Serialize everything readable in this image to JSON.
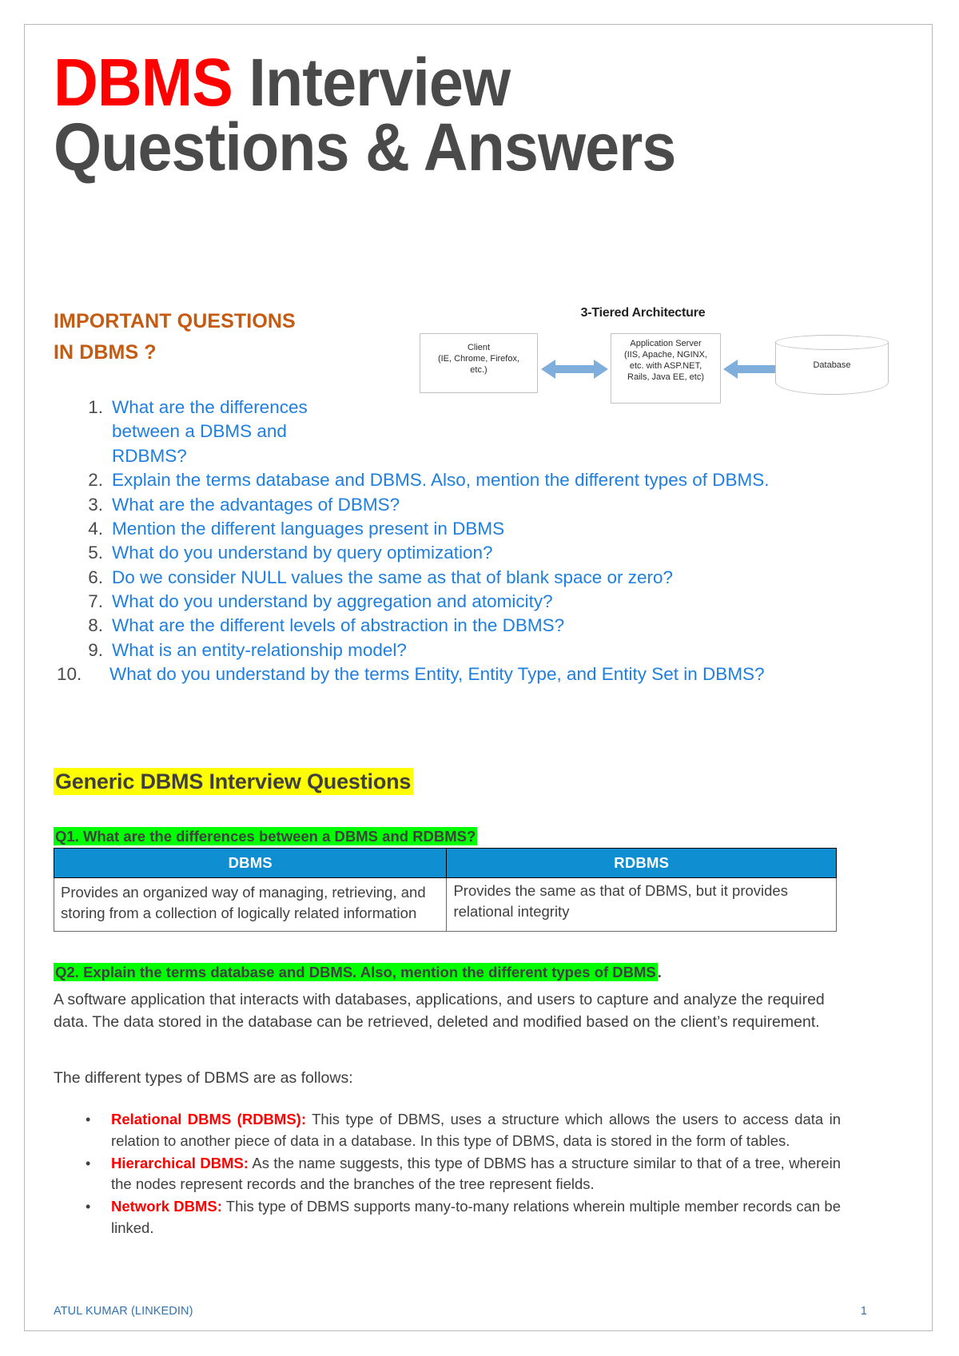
{
  "document": {
    "title_red": "DBMS",
    "title_rest": " Interview Questions & Answers",
    "title_line1_rest": " Interview",
    "title_line2": "Questions & Answers"
  },
  "important_heading": {
    "line1": "IMPORTANT QUESTIONS",
    "line2": "IN DBMS ?",
    "color": "#C55A11"
  },
  "diagram": {
    "title": "3-Tiered Architecture",
    "client_box": "Client\n(IE, Chrome, Firefox,\netc.)",
    "client_label_1": "Client",
    "client_label_2": "(IE, Chrome, Firefox,",
    "client_label_3": "etc.)",
    "app_label_1": "Application Server",
    "app_label_2": "(IIS, Apache, NGINX,",
    "app_label_3": "etc. with ASP.NET,",
    "app_label_4": "Rails, Java EE, etc)",
    "database_label": "Database",
    "arrow_color": "#7FAEDC"
  },
  "question_list": [
    {
      "num": "1.",
      "text": "What are the differences between a DBMS and RDBMS?"
    },
    {
      "num": "2.",
      "text": "Explain the terms database and DBMS. Also, mention the different types of DBMS."
    },
    {
      "num": "3.",
      "text": "What are the advantages of DBMS?"
    },
    {
      "num": "4.",
      "text": "Mention the different languages present in DBMS"
    },
    {
      "num": "5.",
      "text": "What do you understand by query optimization?"
    },
    {
      "num": "6.",
      "text": "Do we consider NULL values the same as that of blank space or zero?"
    },
    {
      "num": "7.",
      "text": "What do you understand by aggregation and atomicity?"
    },
    {
      "num": "8.",
      "text": "What are the different levels of abstraction in the DBMS?"
    },
    {
      "num": "9.",
      "text": "What is an entity-relationship model?"
    },
    {
      "num": "10.",
      "text": "What do you understand by the terms Entity, Entity Type, and Entity Set in DBMS?"
    }
  ],
  "section_heading": {
    "text": "Generic DBMS Interview Questions",
    "highlight_color": "#FFFF00"
  },
  "q1": {
    "heading": "Q1. What are the differences between a DBMS and RDBMS?",
    "highlight_color": "#00FF00",
    "table": {
      "headers": [
        "DBMS",
        "RDBMS"
      ],
      "header_bg": "#0F8ED2",
      "rows": [
        [
          "Provides an organized way of managing, retrieving, and storing from a collection of logically related information",
          "Provides the same as that of DBMS, but it provides relational integrity"
        ]
      ]
    }
  },
  "q2": {
    "heading": "Q2. Explain the terms database and DBMS. Also, mention the different types of DBMS",
    "heading_trailing": ".",
    "highlight_color": "#00FF00",
    "paragraph": "A software application that interacts with databases, applications, and users to capture and analyze the required data. The data stored in the database can be retrieved, deleted and modified based on the client’s requirement.",
    "lead_in": "The different types of DBMS are as follows:",
    "bullets": [
      {
        "term": "Relational DBMS (RDBMS):",
        "body": " This type of DBMS, uses a structure which allows the users to access data in relation to another piece of data in a database. In this type of DBMS, data is stored in the form of tables."
      },
      {
        "term": "Hierarchical DBMS:",
        "body": "  As the name suggests, this type of DBMS has a structure similar to that of a tree, wherein the nodes represent records and the branches of the tree represent fields."
      },
      {
        "term": "Network DBMS:",
        "body": " This type of DBMS supports many-to-many relations wherein multiple member records can be linked."
      }
    ],
    "term_color": "#FF0000"
  },
  "footer": {
    "left": "ATUL KUMAR (LINKEDIN)",
    "page_number": "1",
    "color": "#2E74B5"
  }
}
